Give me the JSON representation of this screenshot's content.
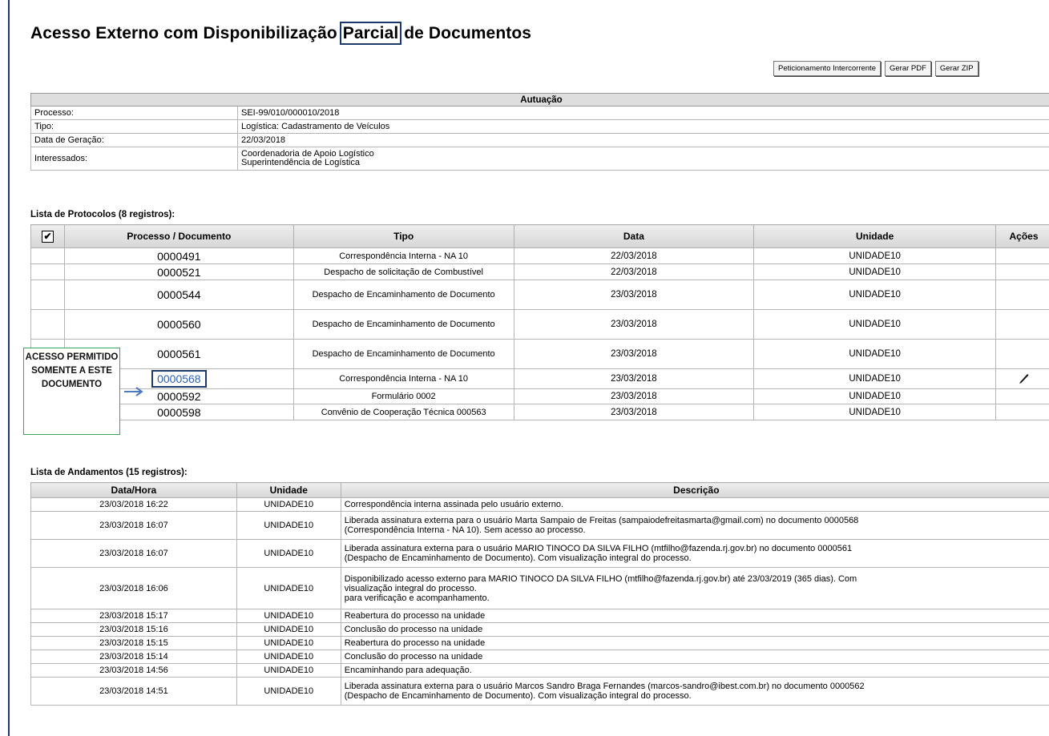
{
  "page": {
    "title_before": "Acesso Externo com Disponibilização ",
    "title_highlight": "Parcial",
    "title_after": " de Documentos"
  },
  "buttons": {
    "peticionamento": "Peticionamento Intercorrente",
    "gerar_pdf": "Gerar PDF",
    "gerar_zip": "Gerar ZIP"
  },
  "autuacao": {
    "header": "Autuação",
    "processo_label": "Processo:",
    "processo_value": "SEI-99/010/000010/2018",
    "tipo_label": "Tipo:",
    "tipo_value": "Logística: Cadastramento de Veículos",
    "data_label": "Data de Geração:",
    "data_value": "22/03/2018",
    "interessados_label": "Interessados:",
    "interessados_1": "Coordenadoria de Apoio Logístico",
    "interessados_2": "Superintendência de Logística"
  },
  "protocolos": {
    "title": "Lista de Protocolos (8 registros):",
    "columns": {
      "check": "✔",
      "doc": "Processo / Documento",
      "tipo": "Tipo",
      "data": "Data",
      "unidade": "Unidade",
      "acoes": "Ações"
    },
    "rows": [
      {
        "doc": "0000491",
        "tipo": "Correspondência Interna - NA 10",
        "data": "22/03/2018",
        "unidade": "UNIDADE10"
      },
      {
        "doc": "0000521",
        "tipo": "Despacho de solicitação de Combustível",
        "data": "22/03/2018",
        "unidade": "UNIDADE10"
      },
      {
        "doc": "0000544",
        "tipo": "Despacho de Encaminhamento de Documento",
        "data": "23/03/2018",
        "unidade": "UNIDADE10"
      },
      {
        "doc": "0000560",
        "tipo": "Despacho de Encaminhamento de Documento",
        "data": "23/03/2018",
        "unidade": "UNIDADE10"
      },
      {
        "doc": "0000561",
        "tipo": "Despacho de Encaminhamento de Documento",
        "data": "23/03/2018",
        "unidade": "UNIDADE10"
      },
      {
        "doc": "0000568",
        "tipo": "Correspondência Interna - NA 10",
        "data": "23/03/2018",
        "unidade": "UNIDADE10",
        "action_icon": "pen-icon"
      },
      {
        "doc": "0000592",
        "tipo": "Formulário 0002",
        "data": "23/03/2018",
        "unidade": "UNIDADE10"
      },
      {
        "doc": "0000598",
        "tipo": "Convênio de Cooperação Técnica 000563",
        "data": "23/03/2018",
        "unidade": "UNIDADE10"
      }
    ]
  },
  "callout": {
    "text": "ACESSO PERMITIDO SOMENTE A ESTE DOCUMENTO",
    "border_color": "#3aa45a"
  },
  "andamentos": {
    "title": "Lista de Andamentos (15 registros):",
    "columns": {
      "datahora": "Data/Hora",
      "unidade": "Unidade",
      "descricao": "Descrição"
    },
    "rows": [
      {
        "datahora": "23/03/2018 16:22",
        "unidade": "UNIDADE10",
        "descricao": "Correspondência interna assinada pelo usuário externo."
      },
      {
        "datahora": "23/03/2018 16:07",
        "unidade": "UNIDADE10",
        "descricao": "Liberada assinatura externa para o usuário Marta Sampaio de Freitas (sampaiodefreitasmarta@gmail.com) no documento 0000568\n(Correspondência Interna - NA 10). Sem acesso ao processo."
      },
      {
        "datahora": "23/03/2018 16:07",
        "unidade": "UNIDADE10",
        "descricao": "Liberada assinatura externa para o usuário MARIO TINOCO DA SILVA FILHO (mtfilho@fazenda.rj.gov.br) no documento 0000561\n(Despacho de Encaminhamento de Documento). Com visualização integral do processo."
      },
      {
        "datahora": "23/03/2018 16:06",
        "unidade": "UNIDADE10",
        "descricao": "Disponibilizado acesso externo para MARIO TINOCO DA SILVA FILHO (mtfilho@fazenda.rj.gov.br) até 23/03/2019 (365 dias). Com\nvisualização integral do processo.\npara verificação e acompanhamento."
      },
      {
        "datahora": "23/03/2018 15:17",
        "unidade": "UNIDADE10",
        "descricao": "Reabertura do processo na unidade"
      },
      {
        "datahora": "23/03/2018 15:16",
        "unidade": "UNIDADE10",
        "descricao": "Conclusão do processo na unidade"
      },
      {
        "datahora": "23/03/2018 15:15",
        "unidade": "UNIDADE10",
        "descricao": "Reabertura do processo na unidade"
      },
      {
        "datahora": "23/03/2018 15:14",
        "unidade": "UNIDADE10",
        "descricao": "Conclusão do processo na unidade"
      },
      {
        "datahora": "23/03/2018 14:56",
        "unidade": "UNIDADE10",
        "descricao": "Encaminhando para adequação."
      },
      {
        "datahora": "23/03/2018 14:51",
        "unidade": "UNIDADE10",
        "descricao": "Liberada assinatura externa para o usuário Marcos Sandro Braga Fernandes (marcos-sandro@ibest.com.br) no documento 0000562\n(Despacho de Encaminhamento de Documento). Com visualização integral do processo."
      }
    ]
  }
}
